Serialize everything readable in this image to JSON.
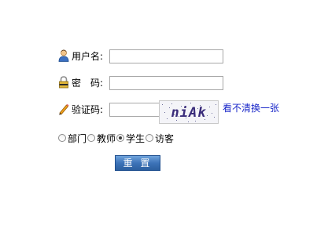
{
  "form": {
    "username": {
      "label": "用户名:",
      "value": "",
      "icon": "user-icon"
    },
    "password": {
      "label": "密　码:",
      "value": "",
      "icon": "lock-icon"
    },
    "captcha": {
      "label": "验证码:",
      "value": "",
      "icon": "pencil-icon",
      "image_text": "niAk",
      "refresh_link": "看不清换一张"
    },
    "roles": {
      "options": [
        "部门",
        "教师",
        "学生",
        "访客"
      ],
      "selected": "学生"
    },
    "reset_label": "重 置"
  },
  "colors": {
    "link": "#1a27c9",
    "button": "#3d73b8",
    "input_border": "#a8a8a8"
  }
}
